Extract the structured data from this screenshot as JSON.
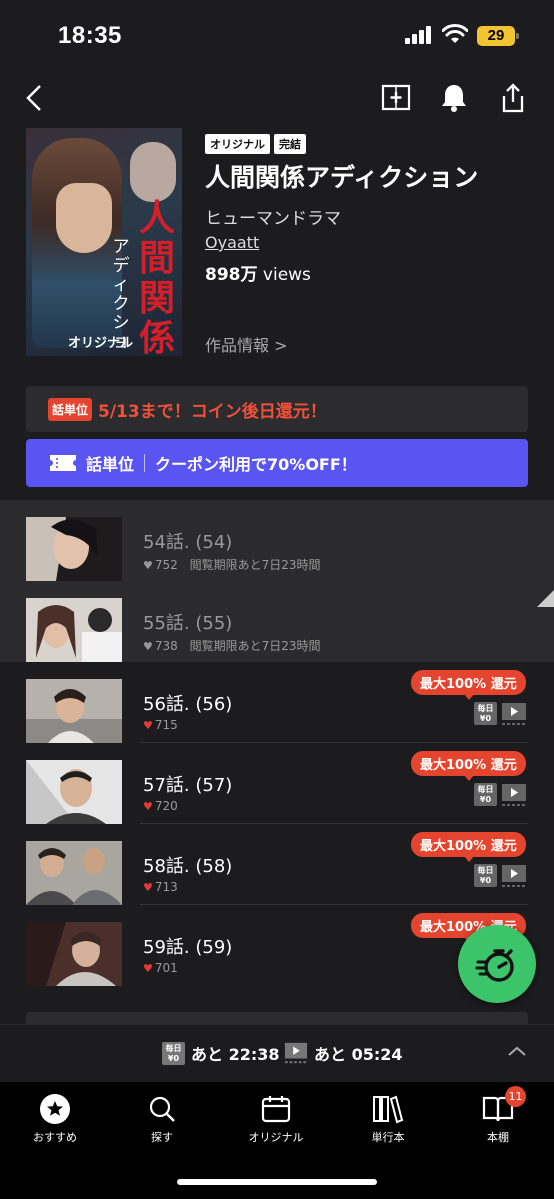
{
  "status_bar": {
    "time": "18:35",
    "battery": "29"
  },
  "series": {
    "tags": [
      "オリジナル",
      "完結"
    ],
    "title": "人間関係アディクション",
    "genre": "ヒューマンドラマ",
    "author": "Oyaatt",
    "views_number": "898万",
    "views_unit": " views",
    "info_link": "作品情報 >",
    "cover_title_lines": [
      "人間",
      "関係"
    ],
    "cover_subtitle": "アディクショ",
    "cover_badge": "オリジナル"
  },
  "promo": {
    "badge": "話単位",
    "text": "5/13まで！コイン後日還元！",
    "coupon_label": "話単位",
    "coupon_text": "クーポン利用で70%OFF！"
  },
  "episodes": [
    {
      "title": "54話. (54)",
      "likes": "752",
      "note": "閲覧期限あと7日23時間"
    },
    {
      "title": "55話. (55)",
      "likes": "738",
      "note": "閲覧期限あと7日23時間"
    },
    {
      "title": "56話. (56)",
      "likes": "715",
      "badge": "最大100% 還元"
    },
    {
      "title": "57話. (57)",
      "likes": "720",
      "badge": "最大100% 還元"
    },
    {
      "title": "58話. (58)",
      "likes": "713",
      "badge": "最大100% 還元"
    },
    {
      "title": "59話. (59)",
      "likes": "701",
      "badge": "最大100% 還元"
    }
  ],
  "mini_icons": {
    "daily_free": "毎日\n¥0"
  },
  "timer": {
    "free_label": "あと 22:38",
    "video_label": "あと 05:24"
  },
  "tabs": [
    {
      "label": "おすすめ"
    },
    {
      "label": "探す"
    },
    {
      "label": "オリジナル"
    },
    {
      "label": "単行本"
    },
    {
      "label": "本棚",
      "badge": "11"
    }
  ],
  "colors": {
    "accent_red": "#e5452f",
    "coupon_blue": "#5a55f2",
    "fab_green": "#3cc46b"
  }
}
